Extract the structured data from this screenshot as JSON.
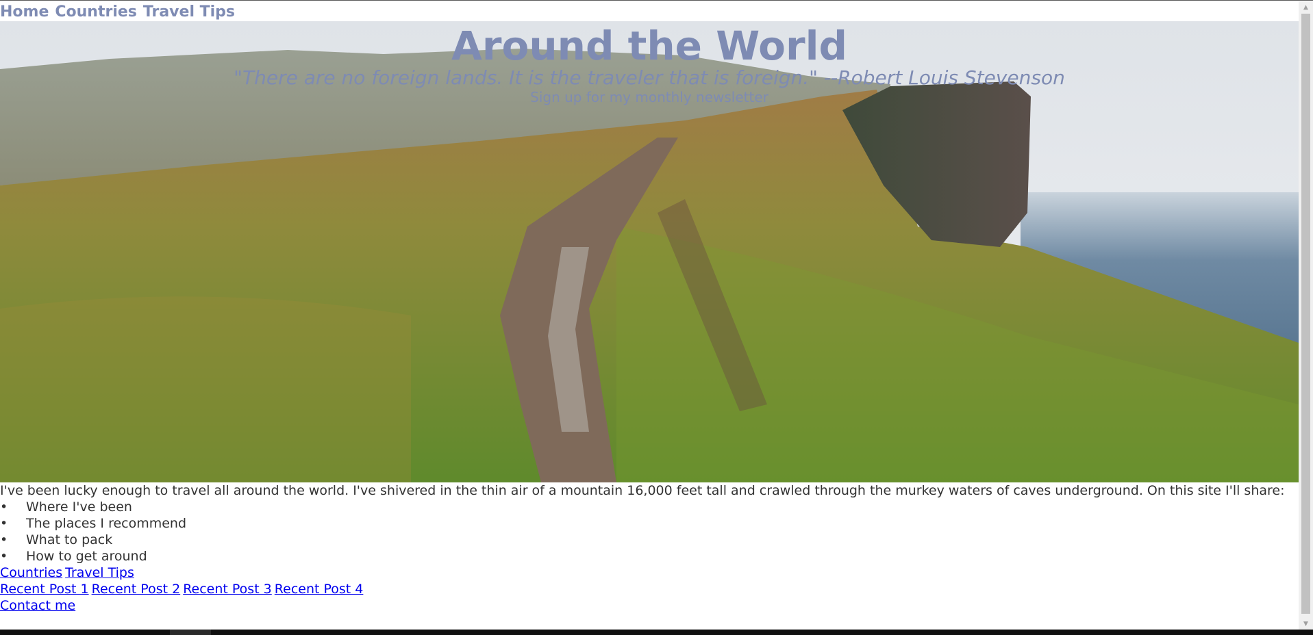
{
  "nav": {
    "items": [
      "Home",
      "Countries",
      "Travel Tips"
    ]
  },
  "hero": {
    "title": "Around the World",
    "quote": "\"There are no foreign lands. It is the traveler that is foreign.\" --Robert Louis Stevenson",
    "signup": "Sign up for my monthly newsletter",
    "image": "cliff-path-landscape"
  },
  "content": {
    "intro": "I've been lucky enough to travel all around the world. I've shivered in the thin air of a mountain 16,000 feet tall and crawled through the murkey waters of caves underground. On this site I'll share:",
    "bullets": [
      "Where I've been",
      "The places I recommend",
      "What to pack",
      "How to get around"
    ],
    "bullet_char": "•",
    "links_row1": [
      "Countries",
      "Travel Tips"
    ],
    "links_row2": [
      "Recent Post 1",
      "Recent Post 2",
      "Recent Post 3",
      "Recent Post 4"
    ],
    "links_row3": [
      "Contact me"
    ]
  },
  "colors": {
    "accent": "#7e8bb3",
    "link": "#0000ee",
    "text": "#333333"
  }
}
